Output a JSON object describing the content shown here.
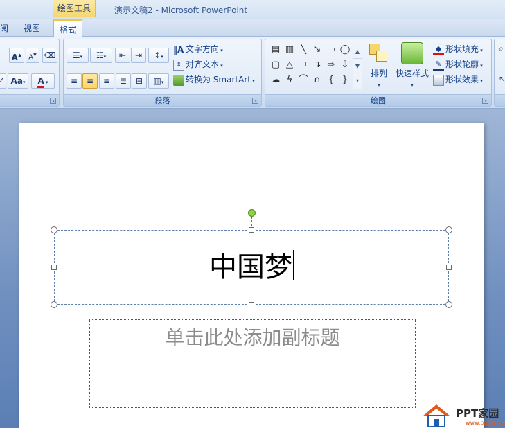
{
  "titlebar": {
    "context_tab": "绘图工具",
    "app_title": "演示文稿2 - Microsoft PowerPoint"
  },
  "tabs": [
    {
      "label": "阅"
    },
    {
      "label": "视图"
    },
    {
      "label": "格式"
    }
  ],
  "ribbon": {
    "paragraph": {
      "group_label": "段落",
      "text_direction": "文字方向",
      "align_text": "对齐文本",
      "convert_smartart": "转换为 SmartArt"
    },
    "drawing": {
      "group_label": "绘图",
      "arrange": "排列",
      "quick_styles": "快速样式",
      "shape_fill": "形状填充",
      "shape_outline": "形状轮廓",
      "shape_effects": "形状效果"
    },
    "font": {
      "grow": "A",
      "shrink": "A",
      "change_case": "Aa",
      "font_color": "A"
    }
  },
  "slide": {
    "title_text": "中国梦",
    "subtitle_placeholder": "单击此处添加副标题"
  },
  "watermark": {
    "brand": "PPT家园",
    "url": "www.pptjia.com"
  },
  "colors": {
    "accent_yellow": "#f5d66e",
    "selection_green": "#8ed046",
    "font_color_red": "#e01010",
    "watermark_orange": "#e05a1a"
  }
}
